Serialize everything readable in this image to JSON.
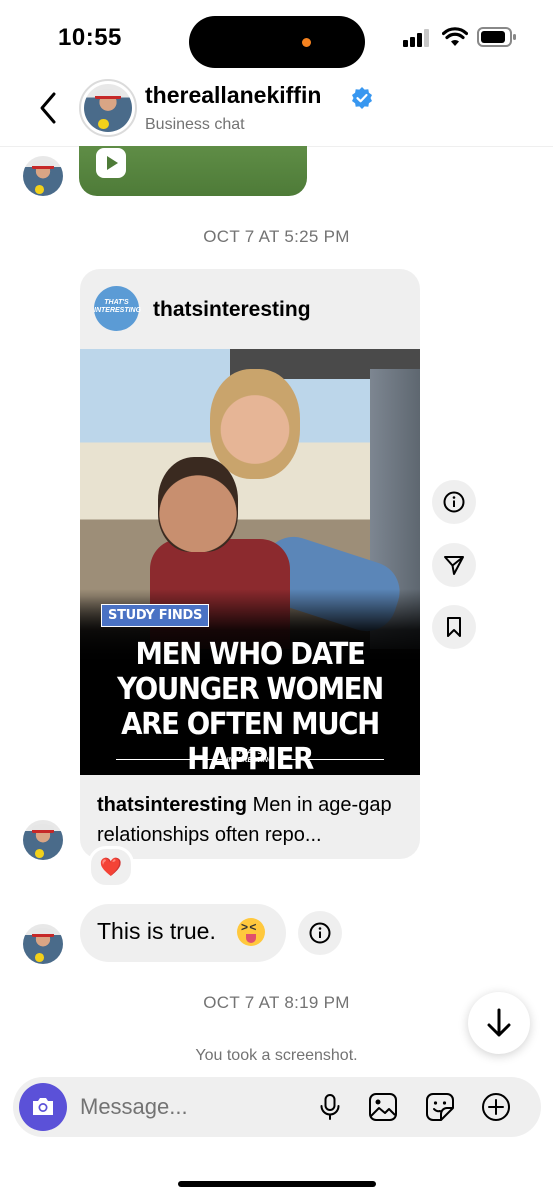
{
  "status_bar": {
    "time": "10:55"
  },
  "header": {
    "username": "thereallanekiffin",
    "subtitle": "Business chat"
  },
  "timestamps": {
    "first": "OCT 7 AT 5:25 PM",
    "second": "OCT 7 AT 8:19 PM"
  },
  "shared_post": {
    "account": "thatsinteresting",
    "logo_text": "THAT'S INTERESTING",
    "image_tag": "STUDY FINDS",
    "headline": "MEN WHO DATE YOUNGER WOMEN ARE OFTEN MUCH HAPPIER",
    "caption_user": "thatsinteresting",
    "caption_text": " Men in age-gap relationships often repo..."
  },
  "reaction": "❤️",
  "message": {
    "text": "This is true."
  },
  "system_note": "You took a screenshot.",
  "composer": {
    "placeholder": "Message..."
  },
  "colors": {
    "accent": "#5b51d8",
    "verified": "#3897f0",
    "bubble": "#efefef",
    "heart": "#ed1c24"
  },
  "icons": [
    "back-icon",
    "verified-icon",
    "play-icon",
    "info-icon",
    "share-icon",
    "bookmark-icon",
    "camera-icon",
    "microphone-icon",
    "gallery-icon",
    "sticker-icon",
    "plus-icon",
    "arrow-down-icon",
    "signal-icon",
    "wifi-icon",
    "battery-icon"
  ]
}
